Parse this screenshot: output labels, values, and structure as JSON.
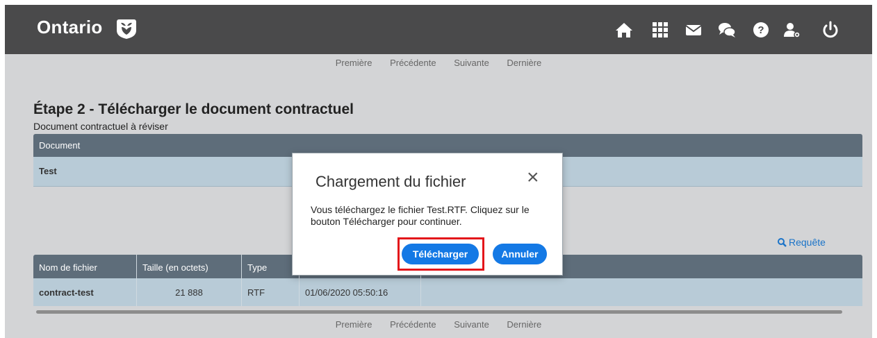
{
  "header": {
    "brand": "Ontario",
    "icons": [
      "home-icon",
      "apps-grid-icon",
      "mail-icon",
      "chat-icon",
      "help-icon",
      "user-settings-icon",
      "power-icon"
    ]
  },
  "pager": {
    "first": "Première",
    "previous": "Précédente",
    "next": "Suivante",
    "last": "Dernière"
  },
  "page": {
    "title": "Étape 2 - Télécharger le document contractuel",
    "subtitle": "Document contractuel à réviser"
  },
  "documents": {
    "header": "Document",
    "rows": [
      "Test"
    ]
  },
  "query_link": "Requête",
  "files": {
    "columns": [
      "Nom de fichier",
      "Taille (en octets)",
      "Type",
      ""
    ],
    "rows": [
      {
        "name": "contract-test",
        "size": "21 888",
        "type": "RTF",
        "date": "01/06/2020 05:50:16"
      }
    ]
  },
  "modal": {
    "title": "Chargement du fichier",
    "close": "×",
    "message": "Vous téléchargez le fichier Test.RTF. Cliquez sur le bouton Télécharger pour continuer.",
    "upload_label": "Télécharger",
    "cancel_label": "Annuler"
  },
  "colors": {
    "header_bg": "#4a4a4b",
    "page_bg": "#d3d4d6",
    "table_head": "#5e6d7a",
    "table_row": "#b8cbd7",
    "accent": "#1479e5",
    "highlight": "#e3151a"
  }
}
